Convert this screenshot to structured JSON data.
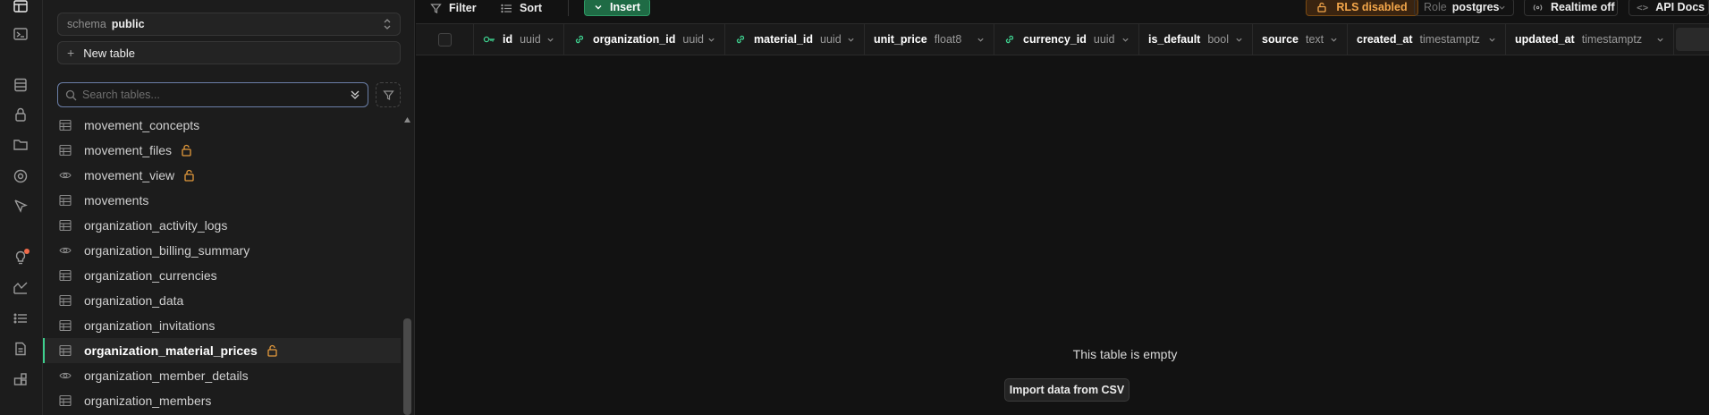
{
  "rail": {
    "icons": [
      "table-editor-icon",
      "sql-editor-icon",
      "database-icon",
      "auth-icon",
      "storage-icon",
      "edge-functions-icon",
      "realtime-icon",
      "advisors-icon",
      "reports-icon",
      "logs-icon",
      "api-docs-icon",
      "integrations-icon"
    ]
  },
  "sidebar": {
    "schema_label": "schema",
    "schema_value": "public",
    "new_table_label": "New table",
    "search_placeholder": "Search tables...",
    "tables": [
      {
        "name": "movement_concepts",
        "type": "table",
        "locked": false
      },
      {
        "name": "movement_files",
        "type": "table",
        "locked": true
      },
      {
        "name": "movement_view",
        "type": "view",
        "locked": true
      },
      {
        "name": "movements",
        "type": "table",
        "locked": false
      },
      {
        "name": "organization_activity_logs",
        "type": "table",
        "locked": false
      },
      {
        "name": "organization_billing_summary",
        "type": "view",
        "locked": false
      },
      {
        "name": "organization_currencies",
        "type": "table",
        "locked": false
      },
      {
        "name": "organization_data",
        "type": "table",
        "locked": false
      },
      {
        "name": "organization_invitations",
        "type": "table",
        "locked": false
      },
      {
        "name": "organization_material_prices",
        "type": "table",
        "locked": true,
        "active": true
      },
      {
        "name": "organization_member_details",
        "type": "view",
        "locked": false
      },
      {
        "name": "organization_members",
        "type": "table",
        "locked": false
      }
    ]
  },
  "toolbar": {
    "filter_label": "Filter",
    "sort_label": "Sort",
    "insert_label": "Insert",
    "rls_label": "RLS disabled",
    "role_label": "Role",
    "role_value": "postgres",
    "realtime_label": "Realtime off",
    "api_docs_label": "API Docs"
  },
  "columns": [
    {
      "name": "id",
      "type": "uuid",
      "icon": "key-icon"
    },
    {
      "name": "organization_id",
      "type": "uuid",
      "icon": "link-icon"
    },
    {
      "name": "material_id",
      "type": "uuid",
      "icon": "link-icon"
    },
    {
      "name": "unit_price",
      "type": "float8",
      "icon": ""
    },
    {
      "name": "currency_id",
      "type": "uuid",
      "icon": "link-icon"
    },
    {
      "name": "is_default",
      "type": "bool",
      "icon": ""
    },
    {
      "name": "source",
      "type": "text",
      "icon": ""
    },
    {
      "name": "created_at",
      "type": "timestamptz",
      "icon": ""
    },
    {
      "name": "updated_at",
      "type": "timestamptz",
      "icon": ""
    }
  ],
  "empty": {
    "title": "This table is empty",
    "import_label": "Import data from CSV"
  },
  "colors": {
    "accent_green": "#3ecf8e",
    "insert_bg": "#1f6b45",
    "rls_warning": "#f3a64a",
    "notification_dot": "#f06b4a"
  }
}
